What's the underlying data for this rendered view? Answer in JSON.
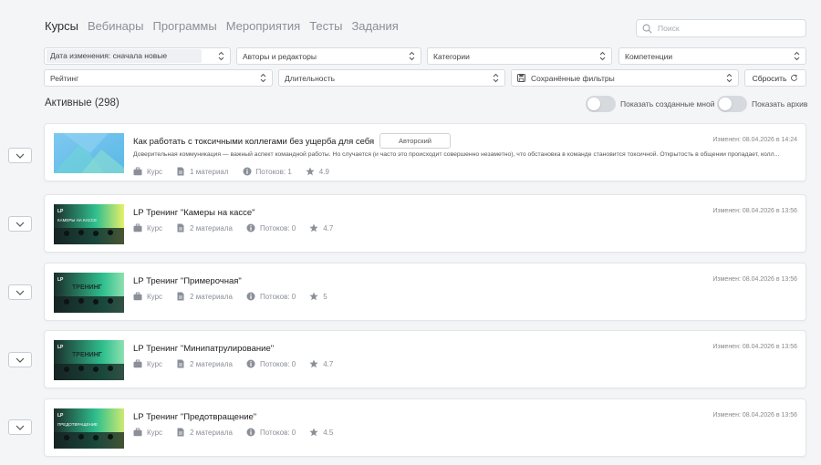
{
  "tabs": [
    "Курсы",
    "Вебинары",
    "Программы",
    "Мероприятия",
    "Тесты",
    "Задания"
  ],
  "search": {
    "placeholder": "Поиск"
  },
  "filters": {
    "sort": "Дата изменения: сначала новые",
    "authors": "Авторы и редакторы",
    "categories": "Категории",
    "competencies": "Компетенции",
    "rating": "Рейтинг",
    "duration": "Длительность",
    "saved": "Сохранённые фильтры",
    "reset": "Сбросить"
  },
  "active_title": "Активные (298)",
  "toggles": {
    "mine": "Показать созданные мной",
    "archive": "Показать архив"
  },
  "colors": {
    "accent": "#4a90e2",
    "thumb_dark": "#1d2a2a",
    "thumb_green": "#2fbf8e"
  },
  "courses": [
    {
      "title": "Как работать с токсичными коллегами без ущерба для себя",
      "badge": "Авторский",
      "description": "Доверительная коммуникация — важный аспект командной работы. Но случается (и часто это происходит совершенно незаметно), что обстановка в команде становится токсичной. Открытость в общении пропадает, колл...",
      "date": "Изменен: 08.04.2026 в 14:24",
      "type": "Курс",
      "materials": "1 материал",
      "streams": "Потоков: 1",
      "rating": "4.9",
      "thumb_text": ""
    },
    {
      "title": "LP Тренинг \"Камеры на кассе\"",
      "date": "Изменен: 08.04.2026 в 13:56",
      "type": "Курс",
      "materials": "2 материала",
      "streams": "Потоков: 0",
      "rating": "4.7",
      "thumb_text": "КАМЕРЫ НА КАССЕ"
    },
    {
      "title": "LP Тренинг \"Примерочная\"",
      "date": "Изменен: 08.04.2026 в 13:56",
      "type": "Курс",
      "materials": "2 материала",
      "streams": "Потоков: 0",
      "rating": "5",
      "thumb_text": "ТРЕНИНГ"
    },
    {
      "title": "LP Тренинг \"Минипатрулирование\"",
      "date": "Изменен: 08.04.2026 в 13:56",
      "type": "Курс",
      "materials": "2 материала",
      "streams": "Потоков: 0",
      "rating": "4.7",
      "thumb_text": "ТРЕНИНГ"
    },
    {
      "title": "LP Тренинг \"Предотвращение\"",
      "date": "Изменен: 08.04.2026 в 13:56",
      "type": "Курс",
      "materials": "2 материала",
      "streams": "Потоков: 0",
      "rating": "4.5",
      "thumb_text": "ПРЕДОТВРАЩЕНИЕ"
    }
  ]
}
